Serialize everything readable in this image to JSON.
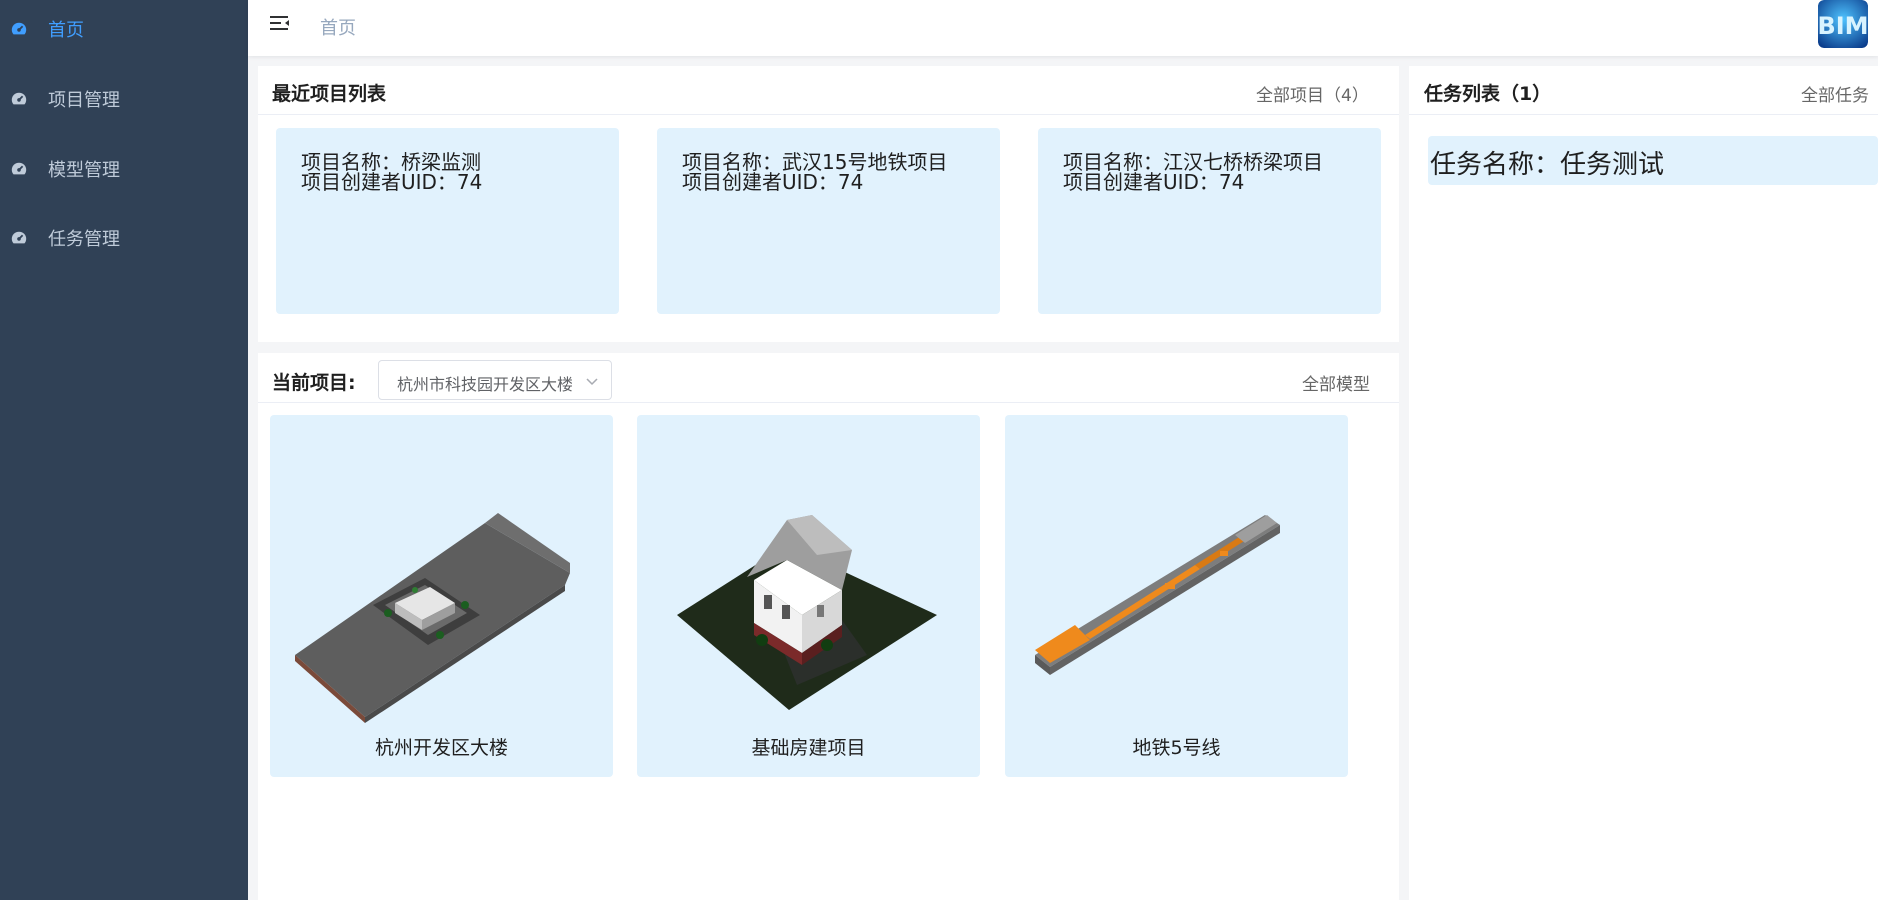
{
  "sidebar": {
    "items": [
      {
        "label": "首页",
        "icon": "dashboard-icon",
        "active": true
      },
      {
        "label": "项目管理",
        "icon": "dashboard-icon",
        "active": false
      },
      {
        "label": "模型管理",
        "icon": "dashboard-icon",
        "active": false
      },
      {
        "label": "任务管理",
        "icon": "dashboard-icon",
        "active": false
      }
    ]
  },
  "header": {
    "breadcrumb": "首页",
    "menu_icon": "hamburger-icon",
    "logo": "BIM"
  },
  "recent_projects": {
    "title": "最近项目列表",
    "all_link": "全部项目（4）",
    "items": [
      {
        "name": "项目名称：桥梁监测",
        "creator": "项目创建者UID：74"
      },
      {
        "name": "项目名称：武汉15号地铁项目",
        "creator": "项目创建者UID：74"
      },
      {
        "name": "项目名称：江汉七桥桥梁项目",
        "creator": "项目创建者UID：74"
      }
    ]
  },
  "current_project": {
    "label": "当前项目:",
    "selected": "杭州市科技园开发区大楼",
    "all_models_link": "全部模型",
    "models": [
      {
        "name": "杭州开发区大楼"
      },
      {
        "name": "基础房建项目"
      },
      {
        "name": "地铁5号线"
      }
    ]
  },
  "tasks": {
    "title": "任务列表（1）",
    "all_link": "全部任务",
    "items": [
      {
        "name": "任务名称：任务测试"
      }
    ]
  },
  "colors": {
    "sidebar_bg": "#304156",
    "active": "#409eff",
    "card_bg": "#e1f2fd"
  }
}
